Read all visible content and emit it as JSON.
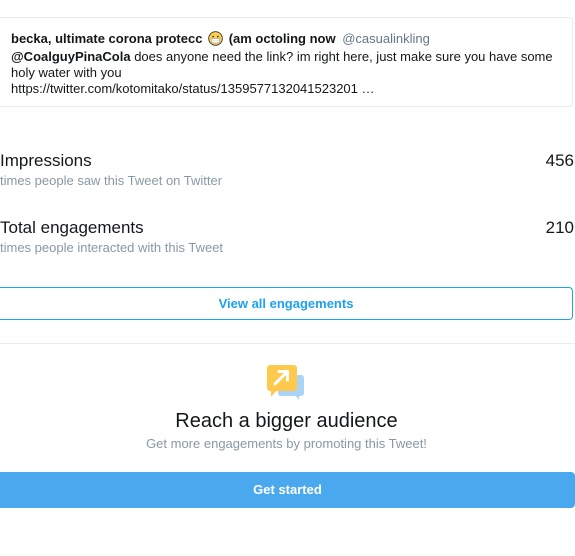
{
  "tweet": {
    "author_name": "becka, ultimate corona protecc",
    "emoji": "face-with-medical-mask",
    "author_name_suffix": "(am octoling now",
    "author_handle": "@casualinkling",
    "mention": "@CoalguyPinaCola",
    "text": " does anyone need the link? im right here, just make sure you have some holy water with you",
    "link": "https://twitter.com/kotomitako/status/1359577132041523201 …"
  },
  "metrics": {
    "impressions": {
      "title": "Impressions",
      "value": "456",
      "description": "times people saw this Tweet on Twitter"
    },
    "engagements": {
      "title": "Total engagements",
      "value": "210",
      "description": "times people interacted with this Tweet"
    }
  },
  "view_all_label": "View all engagements",
  "promote": {
    "icon": "promote-icon",
    "heading": "Reach a bigger audience",
    "subtext": "Get more engagements by promoting this Tweet!",
    "button_label": "Get started"
  },
  "colors": {
    "accent": "#1da1f2",
    "button_fill": "#4aa9ee",
    "secondary_text": "#8899a6"
  }
}
